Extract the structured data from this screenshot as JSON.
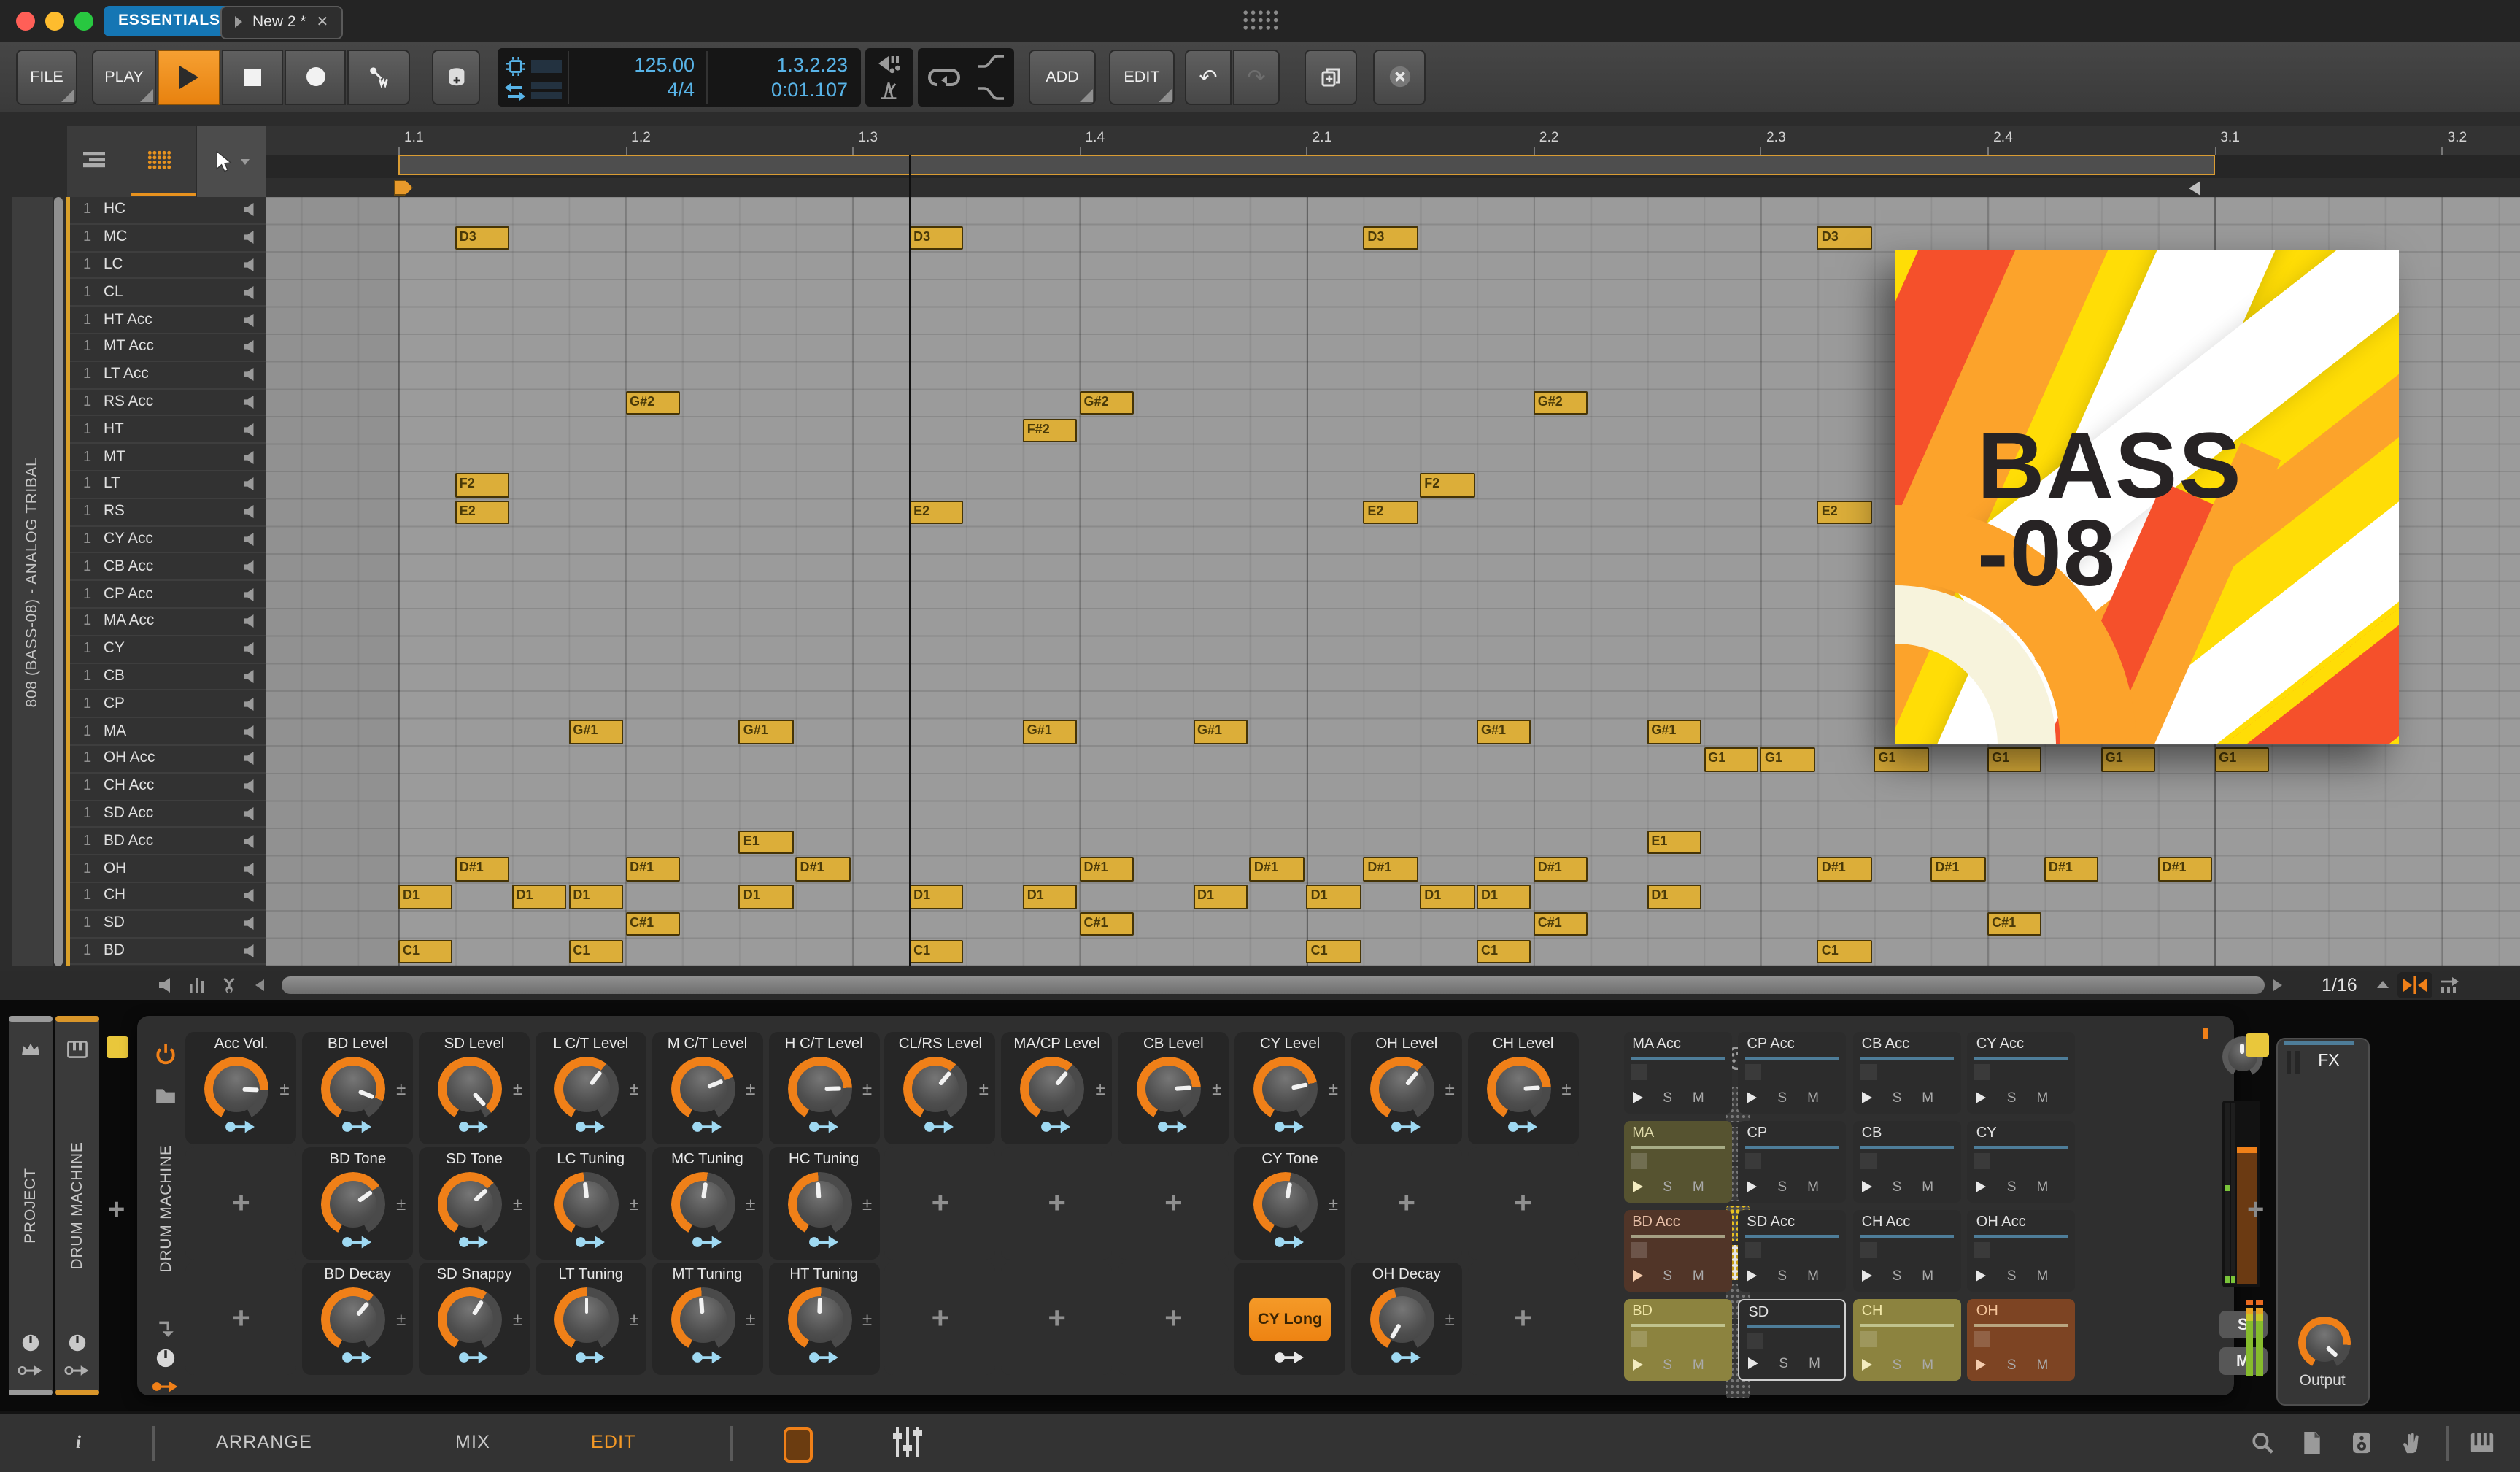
{
  "titlebar": {
    "essentials": "ESSENTIALS",
    "tab_title": "New 2 *",
    "close": "✕"
  },
  "toolbar": {
    "file": "FILE",
    "play": "PLAY",
    "add": "ADD",
    "edit": "EDIT",
    "tempo": "125.00",
    "time_signature": "4/4",
    "position": "1.3.2.23",
    "time": "0:01.107"
  },
  "timeline": {
    "beat_labels": [
      "1.1",
      "1.2",
      "1.3",
      "1.4",
      "2.1",
      "2.2",
      "2.3",
      "2.4",
      "3.1",
      "3.2"
    ],
    "snap": "1/16"
  },
  "clip": {
    "chain_label": "808 (BASS-08) - ANALOG TRIBAL"
  },
  "tracks": [
    {
      "num": "1",
      "name": "HC"
    },
    {
      "num": "1",
      "name": "MC"
    },
    {
      "num": "1",
      "name": "LC"
    },
    {
      "num": "1",
      "name": "CL"
    },
    {
      "num": "1",
      "name": "HT Acc"
    },
    {
      "num": "1",
      "name": "MT Acc"
    },
    {
      "num": "1",
      "name": "LT Acc"
    },
    {
      "num": "1",
      "name": "RS Acc"
    },
    {
      "num": "1",
      "name": "HT"
    },
    {
      "num": "1",
      "name": "MT"
    },
    {
      "num": "1",
      "name": "LT"
    },
    {
      "num": "1",
      "name": "RS"
    },
    {
      "num": "1",
      "name": "CY Acc"
    },
    {
      "num": "1",
      "name": "CB Acc"
    },
    {
      "num": "1",
      "name": "CP Acc"
    },
    {
      "num": "1",
      "name": "MA Acc"
    },
    {
      "num": "1",
      "name": "CY"
    },
    {
      "num": "1",
      "name": "CB"
    },
    {
      "num": "1",
      "name": "CP"
    },
    {
      "num": "1",
      "name": "MA"
    },
    {
      "num": "1",
      "name": "OH Acc"
    },
    {
      "num": "1",
      "name": "CH Acc"
    },
    {
      "num": "1",
      "name": "SD Acc"
    },
    {
      "num": "1",
      "name": "BD Acc"
    },
    {
      "num": "1",
      "name": "OH"
    },
    {
      "num": "1",
      "name": "CH"
    },
    {
      "num": "1",
      "name": "SD"
    },
    {
      "num": "1",
      "name": "BD"
    }
  ],
  "note_rows": [
    {
      "label": "D3",
      "row": 1,
      "beats": [
        0.25,
        2.25,
        4.25,
        6.25
      ]
    },
    {
      "label": "G#2",
      "row": 7,
      "beats": [
        1,
        3,
        5
      ]
    },
    {
      "label": "F#2",
      "row": 8,
      "beats": [
        2.75
      ]
    },
    {
      "label": "F2",
      "row": 10,
      "beats": [
        0.25,
        4.5
      ]
    },
    {
      "label": "E2",
      "row": 11,
      "beats": [
        0.25,
        2.25,
        4.25,
        6.25
      ]
    },
    {
      "label": "G#1",
      "row": 19,
      "beats": [
        0.75,
        1.5,
        2.75,
        3.5,
        4.75,
        5.5
      ]
    },
    {
      "label": "G1",
      "row": 20,
      "beats": [
        5.75,
        6,
        6.5,
        7,
        7.5,
        8
      ]
    },
    {
      "label": "E1",
      "row": 23,
      "beats": [
        1.5,
        5.5
      ]
    },
    {
      "label": "D#1",
      "row": 24,
      "beats": [
        0.25,
        1,
        1.75,
        3,
        3.75,
        4.25,
        5,
        6.25,
        6.75,
        7.25,
        7.75
      ]
    },
    {
      "label": "D1",
      "row": 25,
      "beats": [
        0,
        0.5,
        0.75,
        1.5,
        2.25,
        2.75,
        3.5,
        4,
        4.5,
        4.75,
        5.5
      ]
    },
    {
      "label": "C#1",
      "row": 26,
      "beats": [
        1,
        3,
        5,
        7
      ]
    },
    {
      "label": "C1",
      "row": 27,
      "beats": [
        0,
        0.75,
        2.25,
        4,
        4.75,
        6.25
      ]
    }
  ],
  "artwork": {
    "title_line1": "BASS",
    "title_line2": "-08",
    "palette": {
      "yellow": "#ffdd06",
      "orange": "#fca32b",
      "red_orange": "#f5502b",
      "white": "#ffffff",
      "cream": "#f7f3dc"
    }
  },
  "device": {
    "project_label": "PROJECT",
    "machine_label": "DRUM MACHINE",
    "device_name": "DRUM MACHINE",
    "accent": "#f08018",
    "knob_rows": [
      [
        {
          "label": "Acc Vol.",
          "angle": 92
        },
        {
          "label": "BD Level",
          "angle": 112
        },
        {
          "label": "SD Level",
          "angle": 138
        },
        {
          "label": "L C/T Level",
          "angle": 38
        },
        {
          "label": "M C/T Level",
          "angle": 68
        },
        {
          "label": "H C/T Level",
          "angle": 88
        },
        {
          "label": "CL/RS Level",
          "angle": 40
        },
        {
          "label": "MA/CP Level",
          "angle": 40
        },
        {
          "label": "CB Level",
          "angle": 86
        },
        {
          "label": "CY Level",
          "angle": 78
        },
        {
          "label": "OH Level",
          "angle": 40
        },
        {
          "label": "CH Level",
          "angle": 86
        }
      ],
      [
        null,
        {
          "label": "BD Tone",
          "angle": 55
        },
        {
          "label": "SD Tone",
          "angle": 48
        },
        {
          "label": "LC Tuning",
          "angle": -6
        },
        {
          "label": "MC Tuning",
          "angle": 8
        },
        {
          "label": "HC Tuning",
          "angle": -4
        },
        null,
        null,
        null,
        {
          "label": "CY Tone",
          "angle": 10
        },
        null,
        null
      ],
      [
        null,
        {
          "label": "BD Decay",
          "angle": 40
        },
        {
          "label": "SD Snappy",
          "angle": 32
        },
        {
          "label": "LT Tuning",
          "angle": 0
        },
        {
          "label": "MT Tuning",
          "angle": -4
        },
        {
          "label": "HT Tuning",
          "angle": 2
        },
        null,
        null,
        null,
        {
          "type": "button",
          "label": "CY Long"
        },
        {
          "label": "OH Decay",
          "angle": 210,
          "arc": 345
        },
        null
      ]
    ],
    "pads": [
      [
        {
          "name": "MA Acc"
        },
        {
          "name": "CP Acc"
        },
        {
          "name": "CB Acc"
        },
        {
          "name": "CY Acc"
        }
      ],
      [
        {
          "name": "MA",
          "color": "#565330",
          "name_color": "#ddd8a8"
        },
        {
          "name": "CP"
        },
        {
          "name": "CB"
        },
        {
          "name": "CY"
        }
      ],
      [
        {
          "name": "BD Acc",
          "color": "#513528",
          "name_color": "#e8c0a8"
        },
        {
          "name": "SD Acc"
        },
        {
          "name": "CH Acc"
        },
        {
          "name": "OH Acc"
        }
      ],
      [
        {
          "name": "BD",
          "color": "#8c833f",
          "name_color": "#f2e8a8"
        },
        {
          "name": "SD",
          "selected": true
        },
        {
          "name": "CH",
          "color": "#8c833f",
          "name_color": "#f2e8a8"
        },
        {
          "name": "OH",
          "color": "#7d4423",
          "name_color": "#f5c49a"
        }
      ]
    ],
    "pad_solo": "S",
    "pad_mute": "M",
    "fx_label": "FX",
    "output_label": "Output",
    "solo": "S",
    "mute": "M",
    "cy_long": "CY Long"
  },
  "statusbar": {
    "views": [
      "ARRANGE",
      "MIX",
      "EDIT"
    ],
    "active_view": "EDIT"
  }
}
